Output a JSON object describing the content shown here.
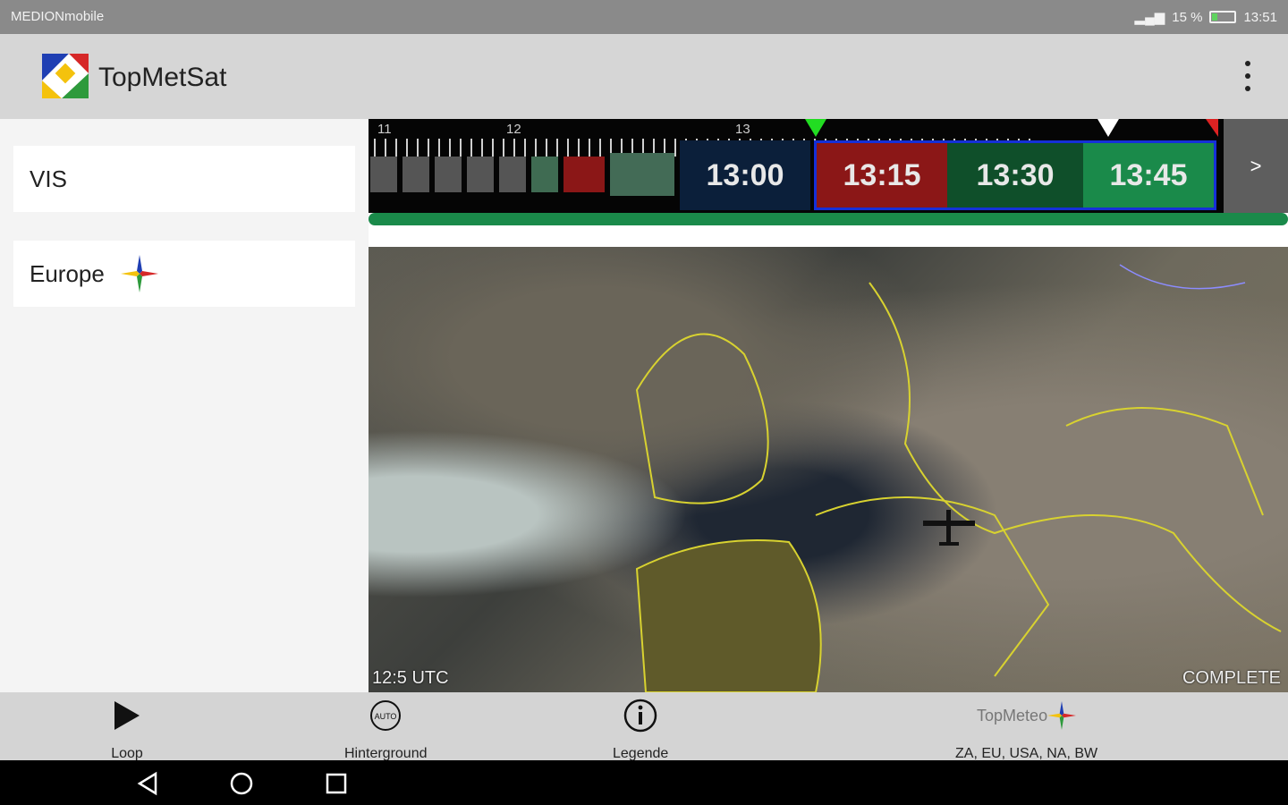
{
  "status": {
    "carrier": "MEDIONmobile",
    "battery": "15 %",
    "time": "13:51"
  },
  "app": {
    "title": "TopMetSat"
  },
  "sidebar": {
    "items": [
      {
        "label": "VIS"
      },
      {
        "label": "Europe"
      }
    ]
  },
  "timeline": {
    "hour_labels": [
      "11",
      "12",
      "13"
    ],
    "frames": [
      {
        "time": "13:00",
        "color": "#0b1f3a"
      },
      {
        "time": "13:15",
        "color": "#8b1717"
      },
      {
        "time": "13:30",
        "color": "#0f4f2a"
      },
      {
        "time": "13:45",
        "color": "#1a8a4a"
      }
    ],
    "next_label": ">"
  },
  "map": {
    "time_label": "12:5 UTC",
    "status_label": "COMPLETE"
  },
  "bottom": {
    "loop_label": "Loop",
    "background_label": "Hinterground",
    "legend_label": "Legende",
    "brand_label": "TopMeteo",
    "regions_label": "ZA, EU, USA, NA, BW"
  }
}
